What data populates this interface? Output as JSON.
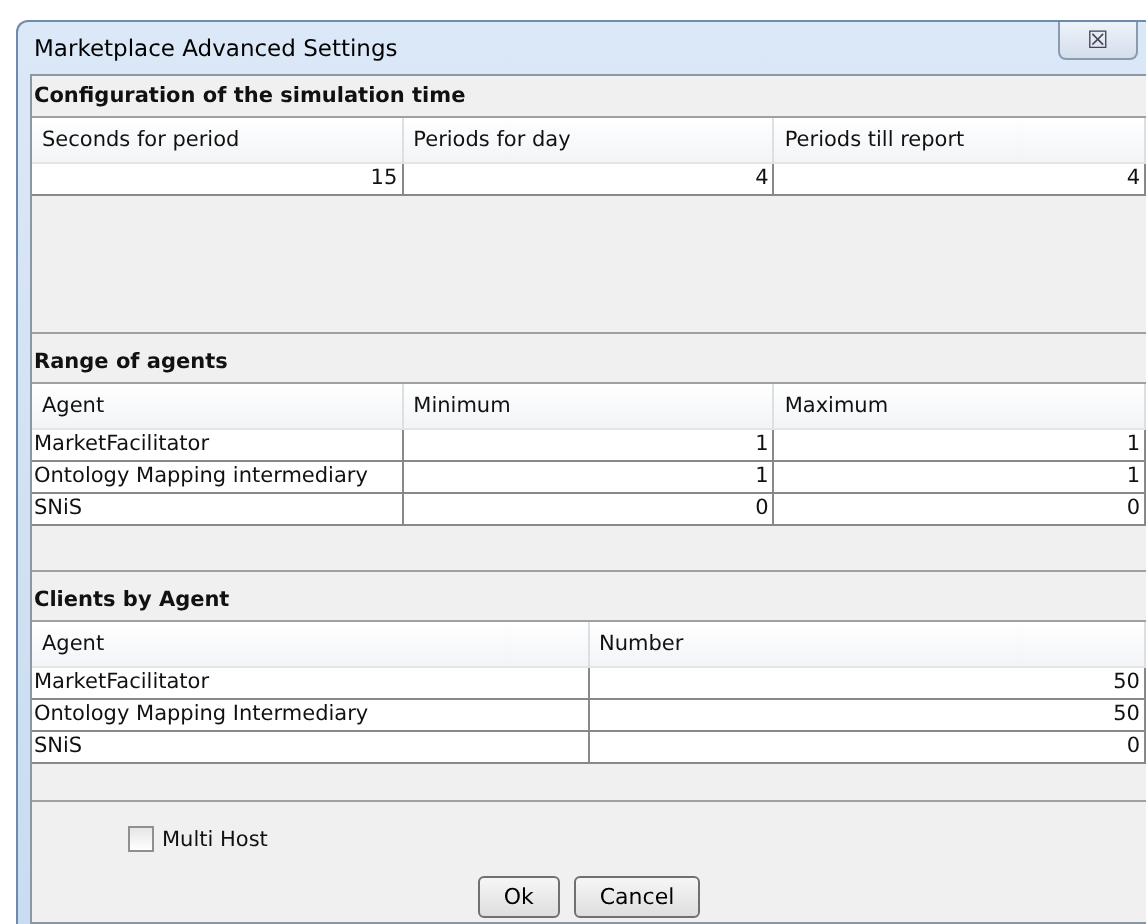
{
  "window": {
    "title": "Marketplace Advanced Settings",
    "close_symbol": "☒"
  },
  "sections": [
    {
      "title": "Configuration of the simulation time",
      "columns": [
        {
          "label": "Seconds for period",
          "kind": "number"
        },
        {
          "label": "Periods for day",
          "kind": "number"
        },
        {
          "label": "Periods till report",
          "kind": "number"
        }
      ],
      "rows": [
        [
          "15",
          "4",
          "4"
        ]
      ]
    },
    {
      "title": "Range of agents",
      "columns": [
        {
          "label": "Agent",
          "kind": "text"
        },
        {
          "label": "Minimum",
          "kind": "number"
        },
        {
          "label": "Maximum",
          "kind": "number"
        }
      ],
      "rows": [
        [
          "MarketFacilitator",
          "1",
          "1"
        ],
        [
          "Ontology Mapping intermediary",
          "1",
          "1"
        ],
        [
          "SNiS",
          "0",
          "0"
        ]
      ]
    },
    {
      "title": "Clients by Agent",
      "columns": [
        {
          "label": "Agent",
          "kind": "text"
        },
        {
          "label": "Number",
          "kind": "number"
        }
      ],
      "rows": [
        [
          "MarketFacilitator",
          "50"
        ],
        [
          "Ontology Mapping Intermediary",
          "50"
        ],
        [
          "SNiS",
          "0"
        ]
      ]
    }
  ],
  "multi_host": {
    "label": "Multi Host",
    "checked": false
  },
  "buttons": [
    "Ok",
    "Cancel"
  ]
}
